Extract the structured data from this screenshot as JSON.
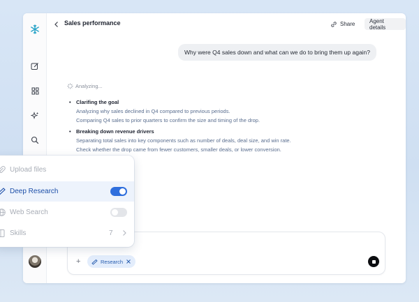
{
  "header": {
    "title": "Sales performance",
    "share_label": "Share",
    "agent_details_label": "Agent details",
    "more_label": "···"
  },
  "sidebar": {
    "icons": [
      "logo-icon",
      "new-chat-icon",
      "grid-icon",
      "sparkle-icon",
      "search-icon"
    ]
  },
  "chat": {
    "user_message": "Why were Q4 sales down and what can we do to bring them up again?",
    "status": "Analyzing...",
    "steps": [
      {
        "title": "Clarifing the goal",
        "lines": [
          "Analyzing why sales declined in Q4 compared to previous periods.",
          "Comparing Q4 sales to prior quarters to confirm the size and timing of the drop."
        ]
      },
      {
        "title": "Breaking down revenue drivers",
        "lines": [
          "Separating total sales into key components such as number of deals, deal size, and win rate.",
          "Check whether the drop came from fewer customers, smaller deals, or lower conversion."
        ]
      }
    ]
  },
  "composer": {
    "placeholder": "...",
    "chip_label": "Research"
  },
  "menu": {
    "items": [
      {
        "label": "Upload files",
        "state": "disabled"
      },
      {
        "label": "Deep Research",
        "state": "active",
        "toggle": true
      },
      {
        "label": "Web Search",
        "state": "disabled",
        "toggle": false
      },
      {
        "label": "Skills",
        "state": "disabled",
        "count": "7"
      }
    ]
  },
  "colors": {
    "accent": "#2f6fdd",
    "logo": "#2aa4c8",
    "step_text": "#5a6e8f"
  }
}
